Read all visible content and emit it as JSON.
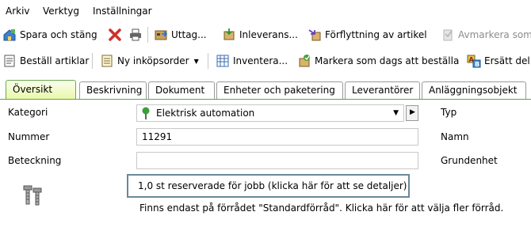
{
  "menu": [
    "Arkiv",
    "Verktyg",
    "Inställningar"
  ],
  "toolbar1": [
    {
      "label": "Spara och stäng",
      "icon": "home-save-icon"
    },
    {
      "label": "",
      "icon": "delete-x-icon"
    },
    {
      "label": "",
      "icon": "printer-icon"
    },
    {
      "label": "Uttag...",
      "icon": "withdrawal-icon"
    },
    {
      "label": "Inleverans...",
      "icon": "delivery-icon"
    },
    {
      "label": "Förflyttning av artikel",
      "icon": "move-article-icon"
    },
    {
      "label": "Avmarkera som",
      "icon": "unmark-icon"
    }
  ],
  "toolbar2": [
    {
      "label": "Beställ artiklar",
      "icon": "order-articles-icon"
    },
    {
      "label": "Ny inköpsorder",
      "icon": "purchase-order-icon"
    },
    {
      "label": "Inventera...",
      "icon": "inventory-icon"
    },
    {
      "label": "Markera som dags att beställa",
      "icon": "mark-order-icon"
    },
    {
      "label": "Ersätt del",
      "icon": "replace-part-icon"
    }
  ],
  "tabs": [
    "Översikt",
    "Beskrivning",
    "Dokument",
    "Enheter och paketering",
    "Leverantörer",
    "Anläggningsobjekt"
  ],
  "form": {
    "kategori_label": "Kategori",
    "kategori_value": "Elektrisk automation",
    "nummer_label": "Nummer",
    "nummer_value": "11291",
    "beteckning_label": "Beteckning",
    "beteckning_value": "",
    "typ_label": "Typ",
    "namn_label": "Namn",
    "grundenhet_label": "Grundenhet",
    "reservation_text": "1,0 st reserverade för jobb (klicka här för att se detaljer)",
    "store_info": "Finns endast på förrådet \"Standardförråd\". Klicka här för att välja fler förråd."
  },
  "colors": {
    "active_tab": "#e8f7a8",
    "highlight_border": "#6a8899",
    "disabled_text": "#8c8c8c"
  }
}
